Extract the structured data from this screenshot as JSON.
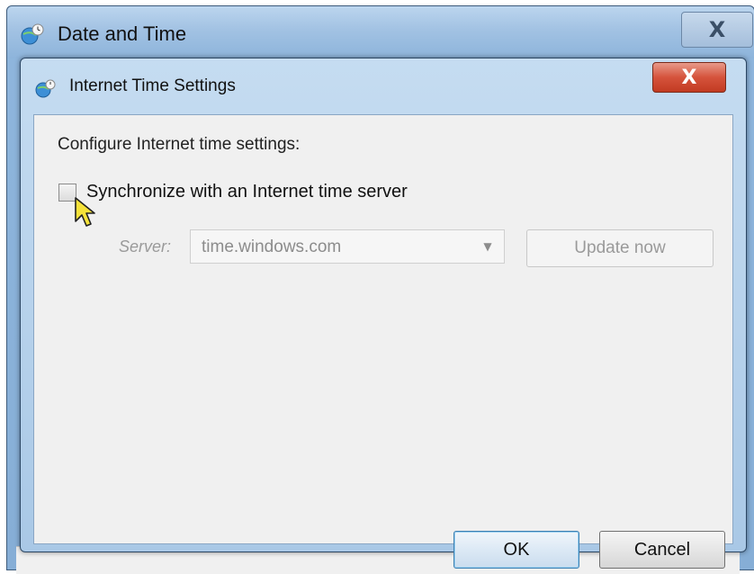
{
  "outer_window": {
    "title": "Date and Time",
    "close_glyph": "X",
    "icon": "clock-globe-icon"
  },
  "dialog": {
    "title": "Internet Time Settings",
    "close_glyph": "X",
    "icon": "clock-globe-icon",
    "heading": "Configure Internet time settings:",
    "sync_checkbox": {
      "label": "Synchronize with an Internet time server",
      "checked": false
    },
    "server": {
      "label": "Server:",
      "value": "time.windows.com",
      "enabled": false
    },
    "update_button": "Update now",
    "ok_button": "OK",
    "cancel_button": "Cancel"
  },
  "colors": {
    "close_red": "#c23b22",
    "ok_focus_border": "#3c7fb1"
  }
}
